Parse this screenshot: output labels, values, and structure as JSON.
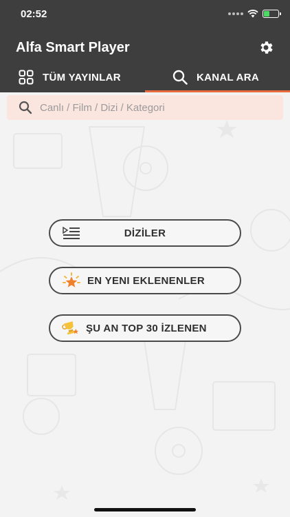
{
  "status_bar": {
    "time": "02:52"
  },
  "header": {
    "title": "Alfa Smart Player",
    "settings_icon": "gear-icon"
  },
  "tabs": [
    {
      "label": "TÜM YAYINLAR",
      "icon": "grid-icon",
      "active": false
    },
    {
      "label": "KANAL ARA",
      "icon": "search-icon",
      "active": true
    }
  ],
  "search": {
    "placeholder": "Canlı / Film / Dizi / Kategori",
    "value": ""
  },
  "menu": {
    "diziler": {
      "label": "DİZİLER",
      "icon": "playlist-icon"
    },
    "yeni": {
      "label": "EN YENI EKLENENLER",
      "icon": "star-burst-icon"
    },
    "top": {
      "label": "ŞU AN TOP 30 İZLENEN",
      "icon": "trophy-icon"
    }
  },
  "colors": {
    "header_bg": "#3e3e3e",
    "accent": "#e86a3f",
    "search_bg": "#fbe6df"
  }
}
